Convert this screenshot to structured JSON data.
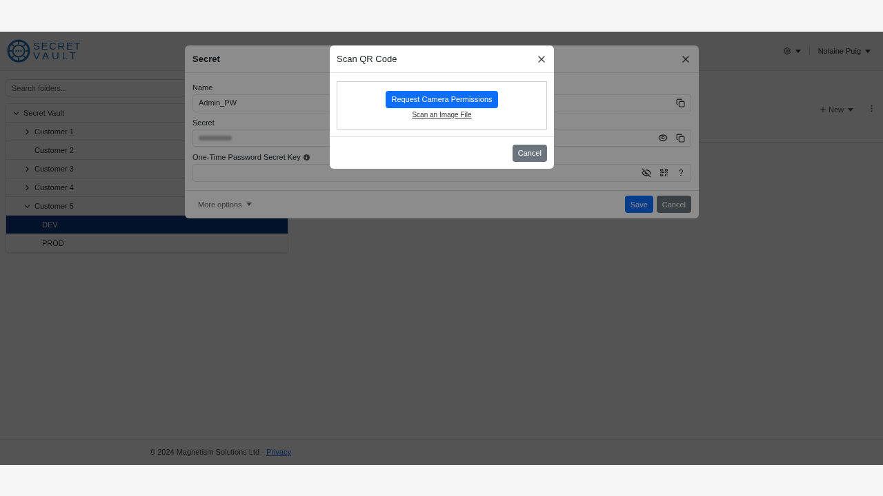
{
  "header": {
    "logo_lines": [
      "SECRET",
      "VAULT"
    ],
    "user": "Nolaine Puig"
  },
  "sidebar": {
    "search": {
      "placeholder": "Search folders..."
    },
    "tree": [
      {
        "label": "Secret Vault",
        "expandable": true,
        "expanded": true,
        "selected": false,
        "children": [
          {
            "label": "Customer 1",
            "expandable": true,
            "expanded": false,
            "selected": false
          },
          {
            "label": "Customer 2",
            "expandable": false,
            "expanded": false,
            "selected": false
          },
          {
            "label": "Customer 3",
            "expandable": true,
            "expanded": false,
            "selected": false
          },
          {
            "label": "Customer 4",
            "expandable": true,
            "expanded": false,
            "selected": false
          },
          {
            "label": "Customer 5",
            "expandable": true,
            "expanded": true,
            "selected": false,
            "children": [
              {
                "label": "DEV",
                "expandable": false,
                "expanded": false,
                "selected": true
              },
              {
                "label": "PROD",
                "expandable": false,
                "expanded": false,
                "selected": false
              }
            ]
          }
        ]
      }
    ]
  },
  "toolbar": {
    "new_button": "New"
  },
  "footer": {
    "copyright": "© 2024 Magnetism Solutions Ltd - ",
    "link": "Privacy"
  },
  "secret_dialog": {
    "title": "Secret",
    "fields": [
      {
        "kind": "name",
        "label": "Name",
        "value": "Admin_PW"
      },
      {
        "kind": "secret",
        "label": "Secret"
      },
      {
        "kind": "otp",
        "label": "One-Time Password Secret Key",
        "help": "?"
      }
    ],
    "more_options": "More options",
    "buttons": [
      "Save",
      "Cancel"
    ]
  },
  "qr_dialog": {
    "title": "Scan QR Code",
    "request_button": "Request Camera Permissions",
    "file_link": "Scan an Image File",
    "cancel": "Cancel"
  }
}
